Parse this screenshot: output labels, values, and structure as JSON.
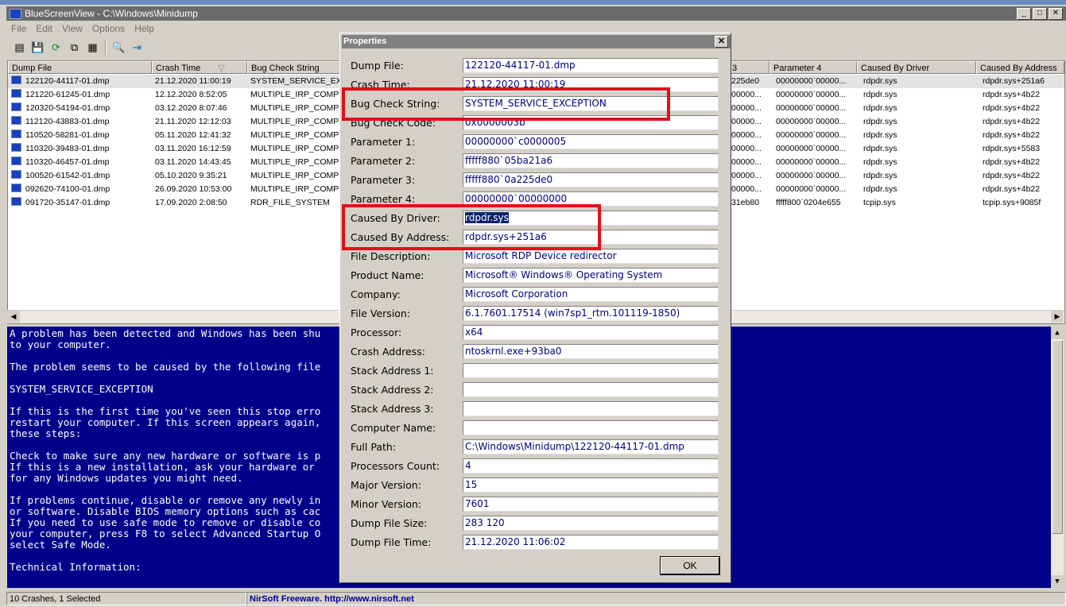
{
  "window": {
    "title": "BlueScreenView  -  C:\\Windows\\Minidump"
  },
  "menu": [
    "File",
    "Edit",
    "View",
    "Options",
    "Help"
  ],
  "toolbar_icons": [
    "properties-icon",
    "save-icon",
    "refresh-icon",
    "copy-icon",
    "report-icon",
    "find-icon",
    "exit-icon"
  ],
  "list": {
    "columns_left": [
      "Dump File",
      "Crash Time",
      "Bug Check String"
    ],
    "columns_right": [
      "3",
      "Parameter 4",
      "Caused By Driver",
      "Caused By Address"
    ],
    "rows": [
      {
        "file": "122120-44117-01.dmp",
        "time": "21.12.2020 11:00:19",
        "bug": "SYSTEM_SERVICE_EXC",
        "p3": "225de0",
        "p4": "00000000`00000...",
        "driver": "rdpdr.sys",
        "addr": "rdpdr.sys+251a6"
      },
      {
        "file": "121220-61245-01.dmp",
        "time": "12.12.2020 8:52:05",
        "bug": "MULTIPLE_IRP_COMPL",
        "p3": "00000...",
        "p4": "00000000`00000...",
        "driver": "rdpdr.sys",
        "addr": "rdpdr.sys+4b22"
      },
      {
        "file": "120320-54194-01.dmp",
        "time": "03.12.2020 8:07:46",
        "bug": "MULTIPLE_IRP_COMPL",
        "p3": "00000...",
        "p4": "00000000`00000...",
        "driver": "rdpdr.sys",
        "addr": "rdpdr.sys+4b22"
      },
      {
        "file": "112120-43883-01.dmp",
        "time": "21.11.2020 12:12:03",
        "bug": "MULTIPLE_IRP_COMPL",
        "p3": "00000...",
        "p4": "00000000`00000...",
        "driver": "rdpdr.sys",
        "addr": "rdpdr.sys+4b22"
      },
      {
        "file": "110520-58281-01.dmp",
        "time": "05.11.2020 12:41:32",
        "bug": "MULTIPLE_IRP_COMPL",
        "p3": "00000...",
        "p4": "00000000`00000...",
        "driver": "rdpdr.sys",
        "addr": "rdpdr.sys+4b22"
      },
      {
        "file": "110320-39483-01.dmp",
        "time": "03.11.2020 16:12:59",
        "bug": "MULTIPLE_IRP_COMPL",
        "p3": "00000...",
        "p4": "00000000`00000...",
        "driver": "rdpdr.sys",
        "addr": "rdpdr.sys+5583"
      },
      {
        "file": "110320-46457-01.dmp",
        "time": "03.11.2020 14:43:45",
        "bug": "MULTIPLE_IRP_COMPL",
        "p3": "00000...",
        "p4": "00000000`00000...",
        "driver": "rdpdr.sys",
        "addr": "rdpdr.sys+4b22"
      },
      {
        "file": "100520-61542-01.dmp",
        "time": "05.10.2020 9:35:21",
        "bug": "MULTIPLE_IRP_COMPL",
        "p3": "00000...",
        "p4": "00000000`00000...",
        "driver": "rdpdr.sys",
        "addr": "rdpdr.sys+4b22"
      },
      {
        "file": "092620-74100-01.dmp",
        "time": "26.09.2020 10:53:00",
        "bug": "MULTIPLE_IRP_COMPL",
        "p3": "00000...",
        "p4": "00000000`00000...",
        "driver": "rdpdr.sys",
        "addr": "rdpdr.sys+4b22"
      },
      {
        "file": "091720-35147-01.dmp",
        "time": "17.09.2020 2:08:50",
        "bug": "RDR_FILE_SYSTEM",
        "p3": "31eb80",
        "p4": "fffff800`0204e655",
        "driver": "tcpip.sys",
        "addr": "tcpip.sys+9085f"
      }
    ]
  },
  "bluescreen": {
    "lines": [
      "A problem has been detected and Windows has been shu",
      "to your computer.",
      "",
      "The problem seems to be caused by the following file",
      "",
      "SYSTEM_SERVICE_EXCEPTION",
      "",
      "If this is the first time you've seen this stop erro",
      "restart your computer. If this screen appears again,",
      "these steps:",
      "",
      "Check to make sure any new hardware or software is p",
      "If this is a new installation, ask your hardware or",
      "for any Windows updates you might need.",
      "",
      "If problems continue, disable or remove any newly in",
      "or software. Disable BIOS memory options such as cac",
      "If you need to use safe mode to remove or disable co",
      "your computer, press F8 to select Advanced Startup O",
      "select Safe Mode.",
      "",
      "Technical Information:"
    ]
  },
  "status": {
    "count": "10 Crashes, 1 Selected",
    "freeware": "NirSoft Freeware.  http://www.nirsoft.net"
  },
  "dialog": {
    "title": "Properties",
    "ok": "OK",
    "fields": [
      {
        "label": "Dump File:",
        "value": "122120-44117-01.dmp"
      },
      {
        "label": "Crash Time:",
        "value": "21.12.2020 11:00:19"
      },
      {
        "label": "Bug Check String:",
        "value": "SYSTEM_SERVICE_EXCEPTION"
      },
      {
        "label": "Bug Check Code:",
        "value": "0x0000003b"
      },
      {
        "label": "Parameter 1:",
        "value": "00000000`c0000005"
      },
      {
        "label": "Parameter 2:",
        "value": "fffff880`05ba21a6"
      },
      {
        "label": "Parameter 3:",
        "value": "fffff880`0a225de0"
      },
      {
        "label": "Parameter 4:",
        "value": "00000000`00000000"
      },
      {
        "label": "Caused By Driver:",
        "value": "rdpdr.sys"
      },
      {
        "label": "Caused By Address:",
        "value": "rdpdr.sys+251a6"
      },
      {
        "label": "File Description:",
        "value": "Microsoft RDP Device redirector"
      },
      {
        "label": "Product Name:",
        "value": "Microsoft® Windows® Operating System"
      },
      {
        "label": "Company:",
        "value": "Microsoft Corporation"
      },
      {
        "label": "File Version:",
        "value": "6.1.7601.17514 (win7sp1_rtm.101119-1850)"
      },
      {
        "label": "Processor:",
        "value": "x64"
      },
      {
        "label": "Crash Address:",
        "value": "ntoskrnl.exe+93ba0"
      },
      {
        "label": "Stack Address 1:",
        "value": ""
      },
      {
        "label": "Stack Address 2:",
        "value": ""
      },
      {
        "label": "Stack Address 3:",
        "value": ""
      },
      {
        "label": "Computer Name:",
        "value": ""
      },
      {
        "label": "Full Path:",
        "value": "C:\\Windows\\Minidump\\122120-44117-01.dmp"
      },
      {
        "label": "Processors Count:",
        "value": "4"
      },
      {
        "label": "Major Version:",
        "value": "15"
      },
      {
        "label": "Minor Version:",
        "value": "7601"
      },
      {
        "label": "Dump File Size:",
        "value": "283  120"
      },
      {
        "label": "Dump File Time:",
        "value": "21.12.2020 11:06:02"
      }
    ]
  }
}
